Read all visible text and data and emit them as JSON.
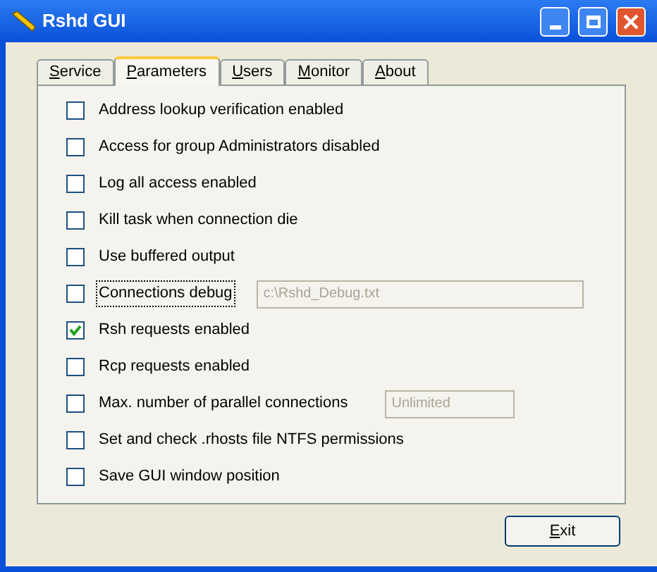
{
  "window": {
    "title": "Rshd GUI"
  },
  "tabs": [
    {
      "label": "Service",
      "selected": false
    },
    {
      "label": "Parameters",
      "selected": true
    },
    {
      "label": "Users",
      "selected": false
    },
    {
      "label": "Monitor",
      "selected": false
    },
    {
      "label": "About",
      "selected": false
    }
  ],
  "options": [
    {
      "kind": "checkbox",
      "label": "Address lookup verification enabled",
      "checked": false,
      "focused": false
    },
    {
      "kind": "checkbox",
      "label": "Access for group Administrators disabled",
      "checked": false,
      "focused": false
    },
    {
      "kind": "checkbox",
      "label": "Log all access enabled",
      "checked": false,
      "focused": false
    },
    {
      "kind": "checkbox",
      "label": "Kill task when connection die",
      "checked": false,
      "focused": false
    },
    {
      "kind": "checkbox",
      "label": "Use buffered output",
      "checked": false,
      "focused": false
    },
    {
      "kind": "wide-field",
      "label": "Connections debug",
      "checked": false,
      "focused": true,
      "value": "c:\\Rshd_Debug.txt"
    },
    {
      "kind": "checkbox",
      "label": "Rsh requests enabled",
      "checked": true,
      "focused": false
    },
    {
      "kind": "checkbox",
      "label": "Rcp requests enabled",
      "checked": false,
      "focused": false
    },
    {
      "kind": "short-field",
      "label": "Max. number of parallel connections",
      "checked": false,
      "focused": false,
      "value": "Unlimited"
    },
    {
      "kind": "checkbox",
      "label": "Set and check .rhosts file NTFS permissions",
      "checked": false,
      "focused": false
    },
    {
      "kind": "checkbox",
      "label": "Save GUI window position",
      "checked": false,
      "focused": false
    }
  ],
  "buttons": [
    {
      "label": "Exit"
    }
  ]
}
